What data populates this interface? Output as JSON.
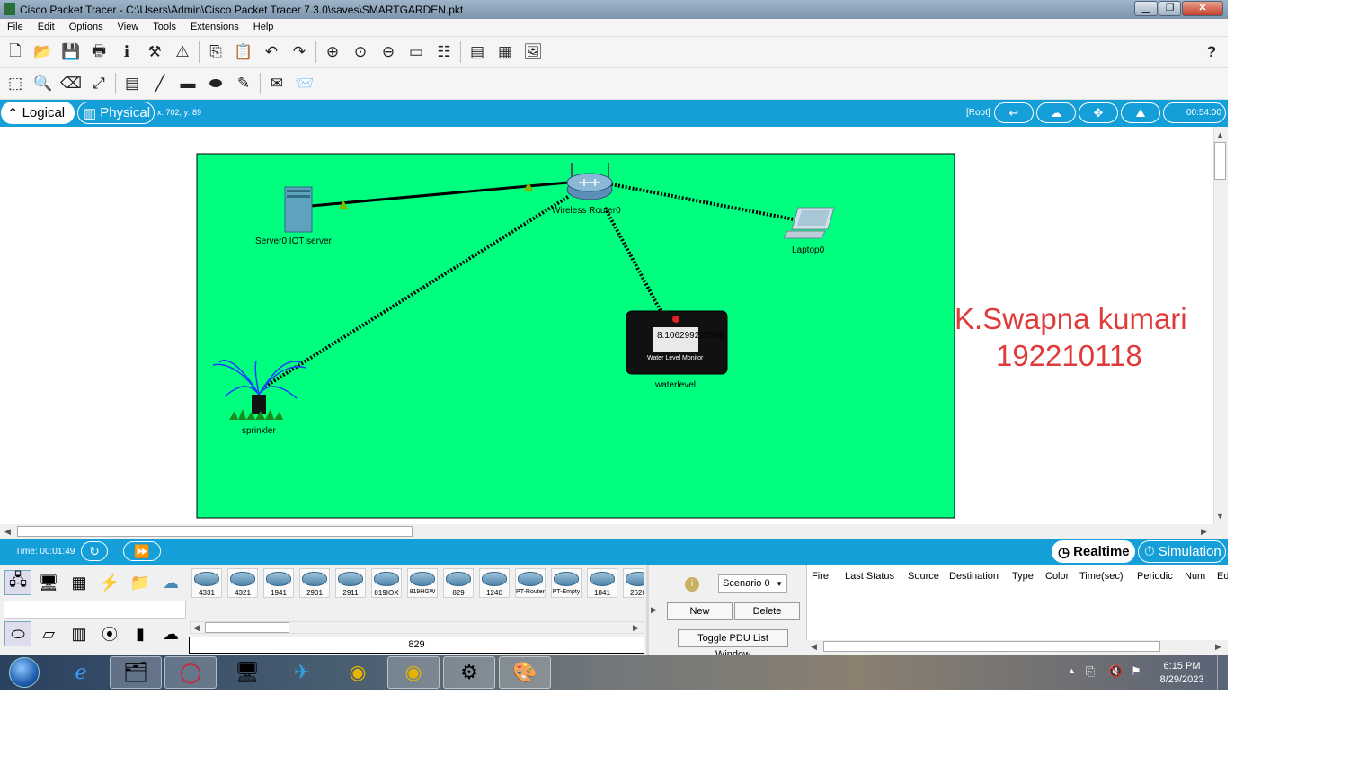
{
  "window": {
    "title": "Cisco Packet Tracer - C:\\Users\\Admin\\Cisco Packet Tracer 7.3.0\\saves\\SMARTGARDEN.pkt"
  },
  "menu": [
    "File",
    "Edit",
    "Options",
    "View",
    "Tools",
    "Extensions",
    "Help"
  ],
  "toolbar": {
    "help_glyph": "?"
  },
  "workspace": {
    "logical_label": "Logical",
    "physical_label": "Physical",
    "coords": "x: 702, y: 89",
    "root_label": "[Root]",
    "clock": "00:54:00"
  },
  "canvas": {
    "background": "#00ff7f",
    "devices": {
      "server": "Server0  IOT server",
      "router": "Wireless Router0",
      "laptop": "Laptop0",
      "monitor": "waterlevel",
      "monitor_reading": "8.106299212598",
      "monitor_caption": "Water Level Monitor",
      "sprinkler": "sprinkler"
    },
    "annotation_line1": "K.Swapna kumari",
    "annotation_line2": "192210118"
  },
  "timebar": {
    "time": "Time: 00:01:49",
    "realtime": "Realtime",
    "simulation": "Simulation"
  },
  "device_panel": {
    "devices": [
      "4331",
      "4321",
      "1941",
      "2901",
      "2911",
      "819IOX",
      "819HGW",
      "829",
      "1240",
      "PT-Router",
      "PT-Empty",
      "1841",
      "2620"
    ],
    "selected": "829"
  },
  "pdu_panel": {
    "scenario": "Scenario 0",
    "new_label": "New",
    "delete_label": "Delete",
    "toggle_label": "Toggle PDU List Window",
    "columns": [
      "Fire",
      "Last Status",
      "Source",
      "Destination",
      "Type",
      "Color",
      "Time(sec)",
      "Periodic",
      "Num",
      "Ed"
    ]
  },
  "taskbar": {
    "time": "6:15 PM",
    "date": "8/29/2023"
  }
}
